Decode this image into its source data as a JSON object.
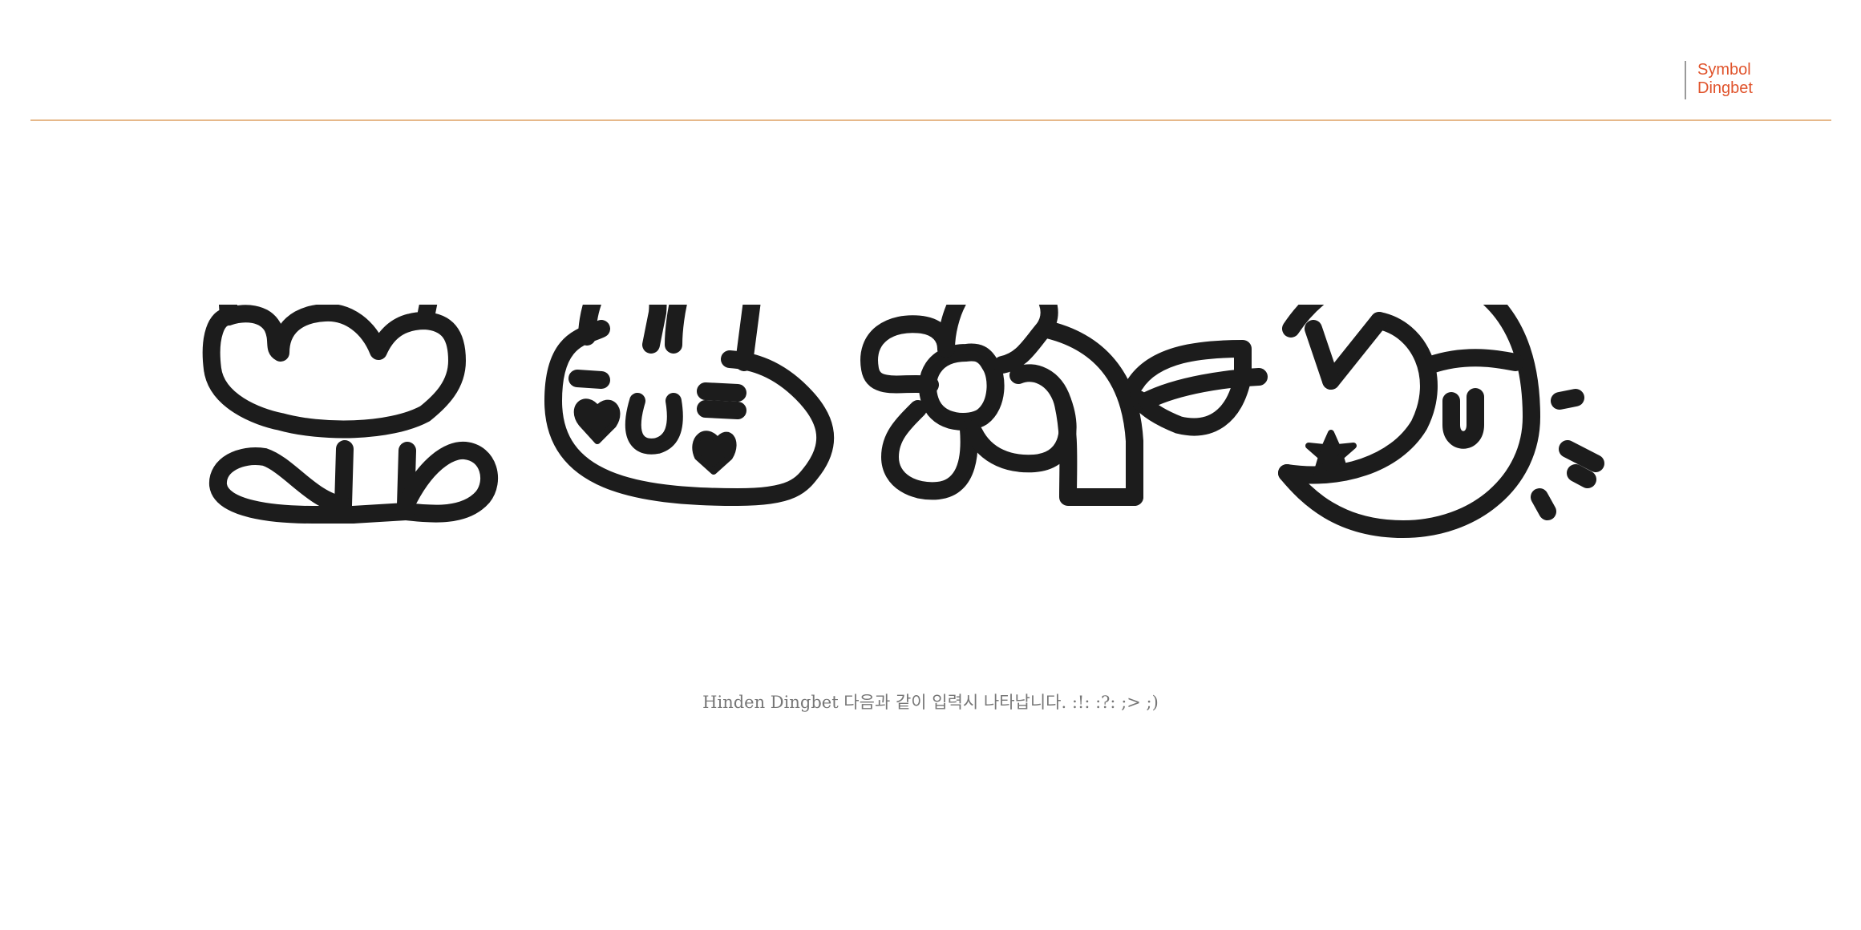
{
  "header": {
    "label_line1": "Symbol",
    "label_line2": "Dingbet",
    "accent_color": "#e0532b",
    "rule_color": "#e6b88a"
  },
  "dingbats": [
    {
      "icon": "crown-creature-icon"
    },
    {
      "icon": "bunny-face-icon"
    },
    {
      "icon": "flower-leaf-icon"
    },
    {
      "icon": "crescent-moon-star-icon"
    }
  ],
  "caption": {
    "text": "Hinden Dingbet 다음과 같이 입력시 나타납니다. :!:  :?:  ;>  ;)"
  }
}
